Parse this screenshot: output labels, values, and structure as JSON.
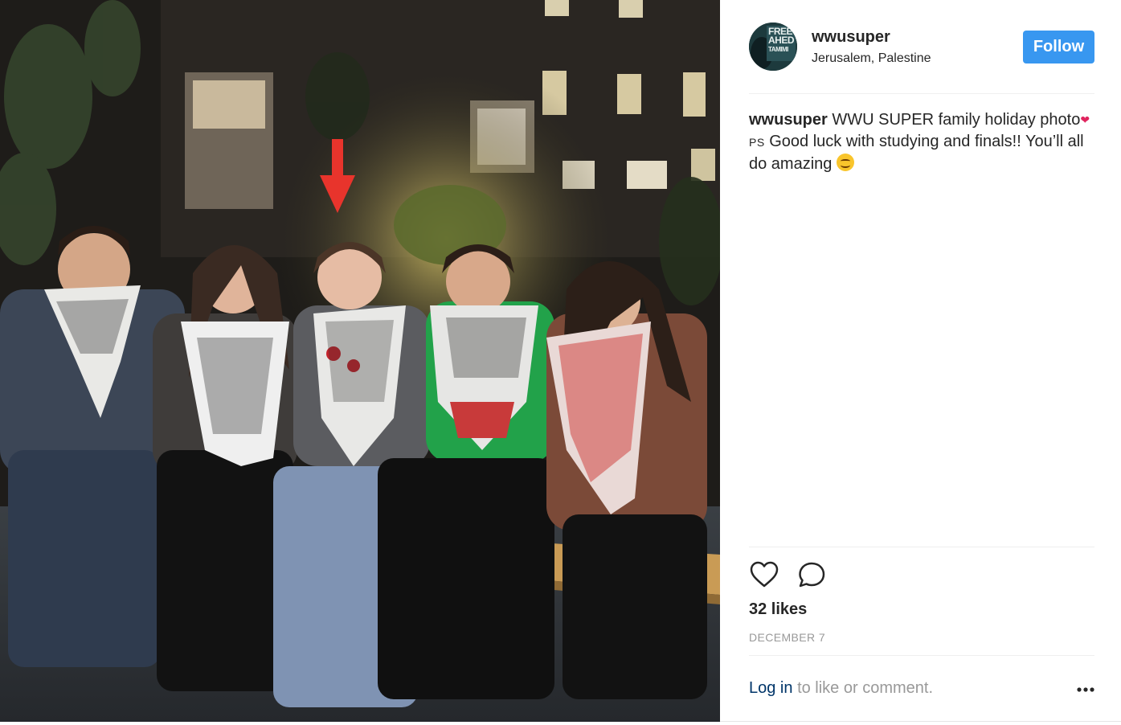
{
  "post": {
    "username": "wwusuper",
    "location": "Jerusalem, Palestine",
    "follow_label": "Follow",
    "avatar_text": [
      "FREE",
      "AHED",
      "TAMIMI"
    ],
    "caption": {
      "username": "wwusuper",
      "line1": "WWU SUPER family holiday photo",
      "heart": "❤",
      "ps": "PS",
      "line2": "Good luck with studying and finals!! You’ll all do amazing"
    },
    "likes": "32 likes",
    "date": "DECEMBER 7",
    "login_link": "Log in",
    "login_rest": "to like or comment."
  },
  "colors": {
    "follow_bg": "#3897f0",
    "link": "#003569",
    "muted": "#999999",
    "arrow": "#e8342c"
  },
  "icons": {
    "like": "heart-outline-icon",
    "comment": "speech-bubble-icon",
    "more": "ellipsis-icon"
  }
}
